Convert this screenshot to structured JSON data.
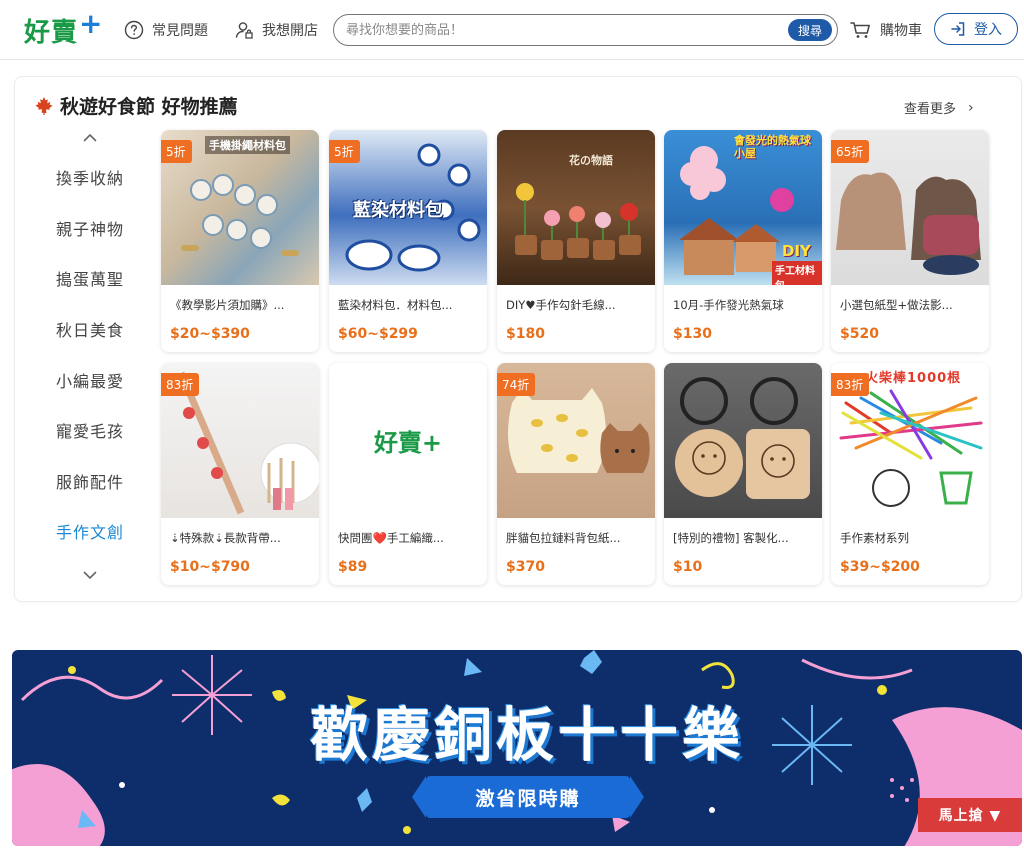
{
  "header": {
    "logo_text": "好賣",
    "logo_plus": "+",
    "faq_label": "常見問題",
    "open_store_label": "我想開店",
    "search_placeholder": "尋找你想要的商品！",
    "search_button": "搜尋",
    "cart_label": "購物車",
    "login_label": "登入"
  },
  "section": {
    "title": "秋遊好食節 好物推薦",
    "more_label": "查看更多"
  },
  "categories": [
    {
      "label": "換季收納",
      "active": false
    },
    {
      "label": "親子神物",
      "active": false
    },
    {
      "label": "搗蛋萬聖",
      "active": false
    },
    {
      "label": "秋日美食",
      "active": false
    },
    {
      "label": "小編最愛",
      "active": false
    },
    {
      "label": "寵愛毛孩",
      "active": false
    },
    {
      "label": "服飾配件",
      "active": false
    },
    {
      "label": "手作文創",
      "active": true
    }
  ],
  "products": [
    {
      "badge": "5折",
      "name": "《教學影片須加購》...",
      "price": "$20~$390",
      "thumb_text": "手機掛繩材料包"
    },
    {
      "badge": "5折",
      "name": "藍染材料包．材料包...",
      "price": "$60~$299",
      "thumb_text": "藍染材料包"
    },
    {
      "badge": "",
      "name": "DIY♥手作勾針毛線...",
      "price": "$180",
      "thumb_text": "花の物語"
    },
    {
      "badge": "",
      "name": "10月-手作發光熱氣球",
      "price": "$130",
      "thumb_text": "會發光的熱氣球小屋",
      "thumb_text2": "DIY",
      "thumb_text3": "手工材料包"
    },
    {
      "badge": "65折",
      "name": "小選包紙型+做法影...",
      "price": "$520",
      "thumb_text": ""
    },
    {
      "badge": "83折",
      "name": "⇣特殊款⇣長款背帶...",
      "price": "$10~$790",
      "thumb_text": ""
    },
    {
      "badge": "",
      "name": "快問團❤️手工編織...",
      "price": "$89",
      "thumb_text": "好賣+"
    },
    {
      "badge": "74折",
      "name": "胖貓包拉鏈料背包紙...",
      "price": "$370",
      "thumb_text": ""
    },
    {
      "badge": "",
      "name": "[特別的禮物] 客製化...",
      "price": "$10",
      "thumb_text": ""
    },
    {
      "badge": "83折",
      "name": "手作素材系列",
      "price": "$39~$200",
      "thumb_text": "火柴棒1000根"
    }
  ],
  "banner": {
    "title": "歡慶銅板十十樂",
    "subtitle": "激省限時購",
    "cta": "馬上搶 ▼"
  },
  "colors": {
    "brand_green": "#1a9a46",
    "brand_blue": "#1e5aa8",
    "accent_orange": "#ef6e22",
    "price_orange": "#e8701a",
    "active_category": "#1a88d4",
    "banner_bg": "#0e2d6b"
  }
}
